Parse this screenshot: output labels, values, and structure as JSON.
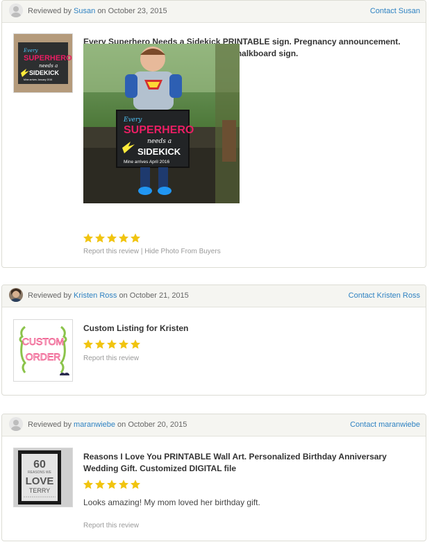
{
  "colors": {
    "accent": "#2e82c2",
    "star": "#f1c40f",
    "header_bg": "#f5f5f1"
  },
  "reviews": [
    {
      "reviewed_by": "Reviewed by",
      "reviewer": "Susan",
      "date_prefix": "on",
      "date": "October 23, 2015",
      "contact": "Contact Susan",
      "title_line1": "Every Superhero Needs a Sidekick PRINTABLE sign. Pregnancy announcement.",
      "title_line2": "Baby arriving. Big Brother Big Sister Chalkboard sign.",
      "thumb_text": {
        "l1": "Every",
        "l2": "SUPERHERO",
        "l3": "needs a",
        "l4": "SIDEKICK",
        "l5": "Mine arrives January 2016"
      },
      "photo_text": {
        "l1": "Every",
        "l2": "SUPERHERO",
        "l3": "needs a",
        "l4": "SIDEKICK",
        "l5": "Mine arrives April 2016"
      },
      "rating": 5,
      "report": "Report this review",
      "separator": "|",
      "hide_photo": "Hide Photo From Buyers"
    },
    {
      "reviewed_by": "Reviewed by",
      "reviewer": "Kristen Ross",
      "date_prefix": "on",
      "date": "October 21, 2015",
      "contact": "Contact Kristen Ross",
      "title": "Custom Listing for Kristen",
      "thumb_text": {
        "l1": "CUSTOM",
        "l2": "ORDER"
      },
      "rating": 5,
      "report": "Report this review"
    },
    {
      "reviewed_by": "Reviewed by",
      "reviewer": "maranwiebe",
      "date_prefix": "on",
      "date": "October 20, 2015",
      "contact": "Contact maranwiebe",
      "title_line1": "Reasons I Love You PRINTABLE Wall Art. Personalized Birthday Anniversary",
      "title_line2": "Wedding Gift. Customized DIGITAL file",
      "thumb_text": {
        "l1": "60",
        "l2": "REASONS WE",
        "l3": "LOVE",
        "l4": "TERRY"
      },
      "rating": 5,
      "text": "Looks amazing! My mom loved her birthday gift.",
      "report": "Report this review"
    }
  ]
}
